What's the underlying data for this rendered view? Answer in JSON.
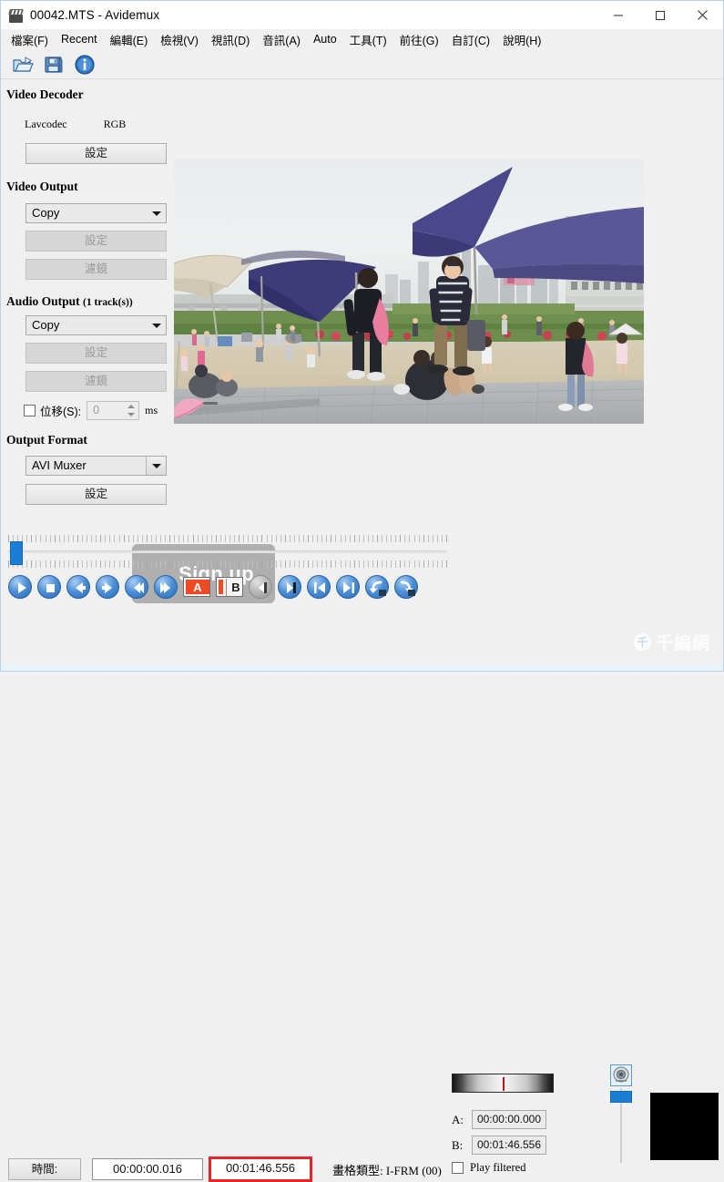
{
  "window": {
    "title": "00042.MTS - Avidemux",
    "icon": "clapperboard-icon",
    "minimize_label": "─",
    "maximize_label": "□",
    "close_label": "✕"
  },
  "menu": {
    "items": [
      {
        "label": "檔案(F)",
        "accel": "F",
        "name": "menu-file"
      },
      {
        "label": "Recent",
        "accel": "R",
        "name": "menu-recent"
      },
      {
        "label": "編輯(E)",
        "accel": "E",
        "name": "menu-edit"
      },
      {
        "label": "檢視(V)",
        "accel": "V",
        "name": "menu-view"
      },
      {
        "label": "視訊(D)",
        "accel": "D",
        "name": "menu-video"
      },
      {
        "label": "音訊(A)",
        "accel": "A",
        "name": "menu-audio"
      },
      {
        "label": "Auto",
        "accel": "A",
        "name": "menu-auto"
      },
      {
        "label": "工具(T)",
        "accel": "T",
        "name": "menu-tools"
      },
      {
        "label": "前往(G)",
        "accel": "G",
        "name": "menu-goto"
      },
      {
        "label": "自訂(C)",
        "accel": "C",
        "name": "menu-custom"
      },
      {
        "label": "說明(H)",
        "accel": "H",
        "name": "menu-help"
      }
    ]
  },
  "toolbar": {
    "icons": [
      {
        "name": "open-folder-icon",
        "title": "Open"
      },
      {
        "name": "save-icon",
        "title": "Save"
      },
      {
        "name": "info-icon",
        "title": "Information"
      }
    ]
  },
  "sidebar": {
    "video_decoder": {
      "heading": "Video Decoder",
      "codec": "Lavcodec",
      "colorspace": "RGB",
      "configure_label": "設定"
    },
    "video_output": {
      "heading": "Video Output",
      "selected": "Copy",
      "configure_label": "設定",
      "filter_label": "濾鏡"
    },
    "audio_output": {
      "heading": "Audio Output",
      "track_note": "(1 track(s))",
      "selected": "Copy",
      "configure_label": "設定",
      "filter_label": "濾鏡",
      "shift_label": "位移(S):",
      "shift_value": "0",
      "shift_unit": "ms",
      "shift_checked": false
    },
    "output_format": {
      "heading": "Output Format",
      "selected": "AVI Muxer",
      "configure_label": "設定"
    }
  },
  "overlay": {
    "signup_label": "Sign up"
  },
  "transport": {
    "buttons": [
      {
        "name": "play-button",
        "glyph": "play"
      },
      {
        "name": "stop-button",
        "glyph": "stop"
      },
      {
        "name": "step-back-button",
        "glyph": "arrow-left"
      },
      {
        "name": "step-forward-button",
        "glyph": "arrow-right"
      },
      {
        "name": "prev-keyframe-button",
        "glyph": "rewind"
      },
      {
        "name": "next-keyframe-button",
        "glyph": "fast-forward"
      },
      {
        "name": "mark-a-button",
        "glyph": "marker-a",
        "letter": "A"
      },
      {
        "name": "mark-b-button",
        "glyph": "marker-b",
        "letter": "B"
      },
      {
        "name": "prev-black-frame-button",
        "glyph": "marker-grey"
      },
      {
        "name": "next-black-frame-button",
        "glyph": "marker-blue"
      },
      {
        "name": "go-start-button",
        "glyph": "skip-start"
      },
      {
        "name": "go-end-button",
        "glyph": "skip-end"
      },
      {
        "name": "prev-scene-button",
        "glyph": "loop-left"
      },
      {
        "name": "next-scene-button",
        "glyph": "loop-right"
      }
    ]
  },
  "markers": {
    "a_key": "A:",
    "a_value": "00:00:00.000",
    "b_key": "B:",
    "b_value": "00:01:46.556",
    "play_filtered_label": "Play filtered",
    "play_filtered_checked": false
  },
  "status": {
    "time_button_label": "時間:",
    "current_time": "00:00:00.016",
    "total_time": "00:01:46.556",
    "total_time_highlight_color": "#e8252a",
    "frame_type_label": "畫格類型: I-FRM (00)"
  },
  "volume": {
    "icon": "speaker-icon"
  },
  "watermark": {
    "logo_glyph": "千",
    "text": "千編網"
  },
  "colors": {
    "accent_blue": "#1a7fd4",
    "marker_red": "#f04a25",
    "highlight_red": "#e8252a",
    "window_border": "#b5d3ea"
  }
}
